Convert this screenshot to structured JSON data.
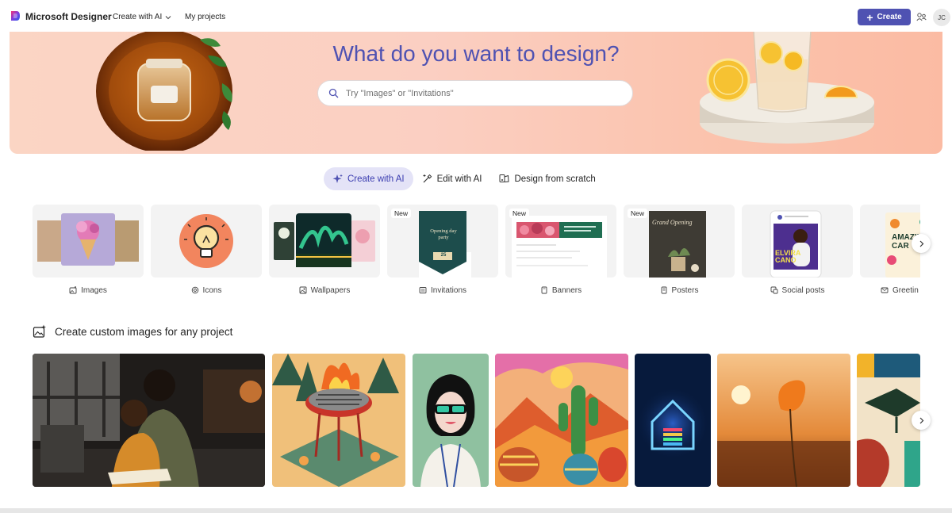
{
  "nav": {
    "brand": "Microsoft Designer",
    "links": [
      {
        "label": "Create with AI",
        "has_dropdown": true
      },
      {
        "label": "My projects",
        "has_dropdown": false
      }
    ],
    "create_button": "Create",
    "avatar_initials": "JC",
    "accent_color": "#4f52b2"
  },
  "hero": {
    "title": "What do you want to design?",
    "search_placeholder": "Try \"Images\" or \"Invitations\""
  },
  "mode_tabs": [
    {
      "label": "Create with AI",
      "active": true,
      "icon": "sparkle-icon"
    },
    {
      "label": "Edit with AI",
      "active": false,
      "icon": "magic-wand-icon"
    },
    {
      "label": "Design from scratch",
      "active": false,
      "icon": "palette-icon"
    }
  ],
  "categories": [
    {
      "label": "Images",
      "icon": "image-sparkle-icon",
      "new": false
    },
    {
      "label": "Icons",
      "icon": "icon-shape-icon",
      "new": false
    },
    {
      "label": "Wallpapers",
      "icon": "wallpaper-icon",
      "new": false
    },
    {
      "label": "Invitations",
      "icon": "invitation-icon",
      "new": true
    },
    {
      "label": "Banners",
      "icon": "banner-icon",
      "new": true
    },
    {
      "label": "Posters",
      "icon": "poster-icon",
      "new": true
    },
    {
      "label": "Social posts",
      "icon": "social-post-icon",
      "new": false
    },
    {
      "label": "Greetin",
      "icon": "mail-icon",
      "new": false
    }
  ],
  "badge_new": "New",
  "thumb_text": {
    "invitation_title": "Opening day party",
    "invitation_date": "25",
    "poster_text": "Grand Opening",
    "social_name": "ELVIRA CANO",
    "greeting_text": "AMAZING CAR"
  },
  "section": {
    "title": "Create custom images for any project"
  }
}
